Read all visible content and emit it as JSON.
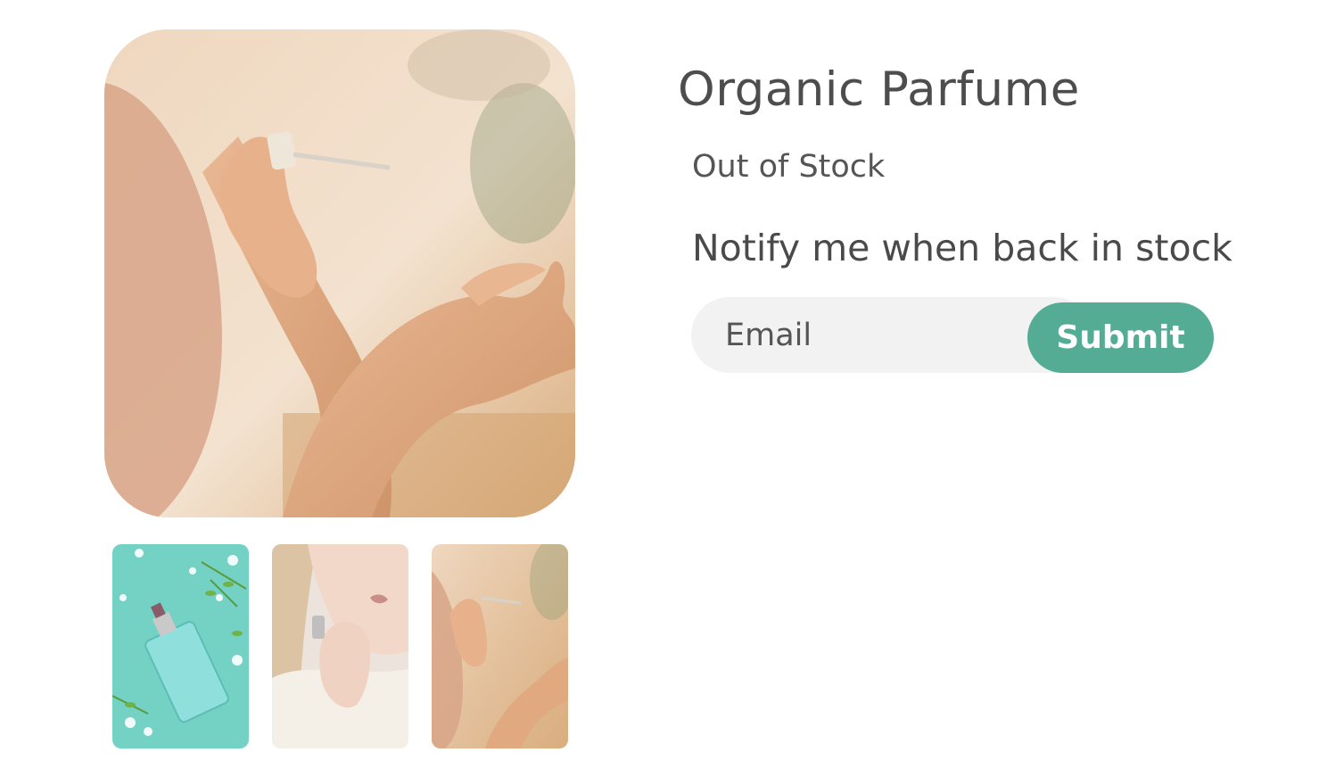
{
  "product": {
    "title": "Organic Parfume",
    "stock_status": "Out of Stock"
  },
  "notify": {
    "heading": "Notify me when back in stock",
    "email_placeholder": "Email",
    "submit_label": "Submit"
  },
  "gallery": {
    "main_image": "hands-applying-perfume-dropper-photo",
    "thumbnails": [
      "perfume-bottle-with-flowers-photo",
      "woman-spraying-perfume-photo",
      "hands-applying-perfume-dropper-photo"
    ]
  },
  "colors": {
    "accent": "#55ac95",
    "text": "#4d4d4d",
    "input_bg": "#f2f2f2"
  }
}
